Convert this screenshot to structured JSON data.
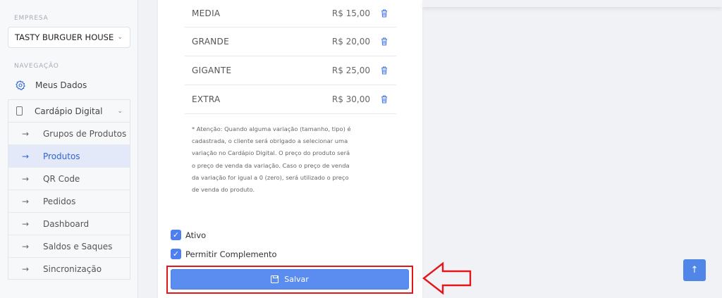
{
  "sidebar": {
    "empresa_label": "EMPRESA",
    "company": "TASTY BURGUER HOUSE",
    "navegacao_label": "NAVEGAÇÃO",
    "meus_dados": "Meus Dados",
    "cardapio": "Cardápio Digital",
    "sub_items": [
      {
        "label": "Grupos de Produtos"
      },
      {
        "label": "Produtos"
      },
      {
        "label": "QR Code"
      },
      {
        "label": "Pedidos"
      },
      {
        "label": "Dashboard"
      },
      {
        "label": "Saldos e Saques"
      },
      {
        "label": "Sincronização"
      }
    ],
    "active_item": "Produtos"
  },
  "variations": [
    {
      "name": "MEDIA",
      "price": "R$ 15,00"
    },
    {
      "name": "GRANDE",
      "price": "R$ 20,00"
    },
    {
      "name": "GIGANTE",
      "price": "R$ 25,00"
    },
    {
      "name": "EXTRA",
      "price": "R$ 30,00"
    }
  ],
  "note": {
    "lines": [
      "* Atenção: Quando alguma variação (tamanho, tipo) é",
      "cadastrada, o cliente será obrigado a selecionar uma",
      "variação no Cardápio Digital. O preço do produto será",
      "o preço de venda da variação. Caso o preço de venda",
      "da variação for igual a 0 (zero), será utilizado o preço",
      "de venda do produto."
    ]
  },
  "checkboxes": {
    "ativo": "Ativo",
    "permitir_complemento": "Permitir Complemento"
  },
  "save_label": "Salvar",
  "icons": {
    "scroll_top": "arrow-up-icon",
    "trash": "trash-icon",
    "gear": "gear-icon"
  },
  "colors": {
    "accent": "#5b8cf0",
    "highlight": "#e3171b",
    "active_bg": "#e3e9f8"
  }
}
